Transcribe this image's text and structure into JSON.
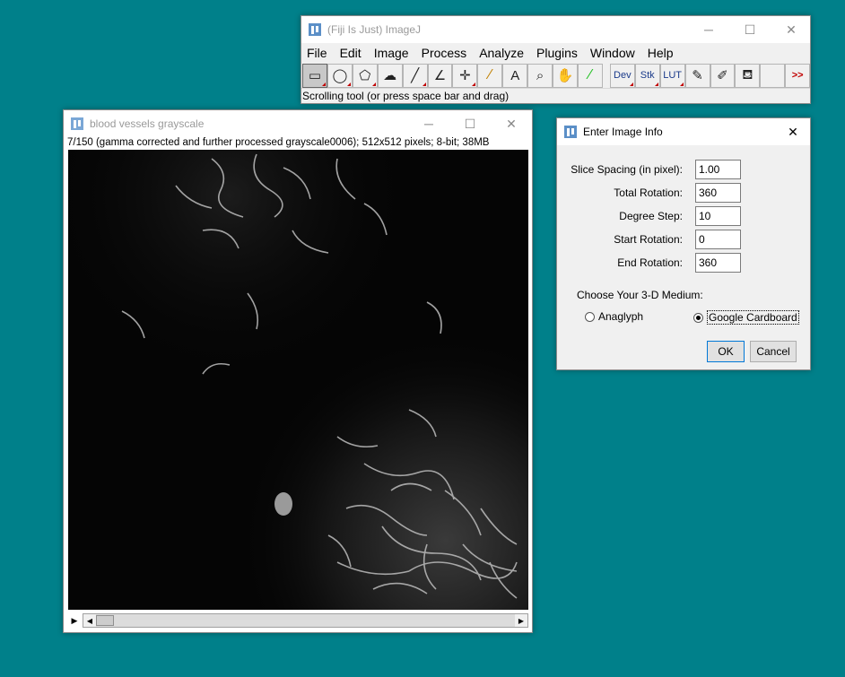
{
  "imagej": {
    "title": "(Fiji Is Just) ImageJ",
    "menus": [
      "File",
      "Edit",
      "Image",
      "Process",
      "Analyze",
      "Plugins",
      "Window",
      "Help"
    ],
    "tools": [
      {
        "icon": "rectangle-select-icon",
        "glyph": "▭",
        "selected": true,
        "menu": true
      },
      {
        "icon": "oval-select-icon",
        "glyph": "◯",
        "menu": true
      },
      {
        "icon": "polygon-select-icon",
        "glyph": "⬠",
        "menu": true
      },
      {
        "icon": "freehand-select-icon",
        "glyph": "☁",
        "menu": false
      },
      {
        "icon": "line-tool-icon",
        "glyph": "╱",
        "menu": true
      },
      {
        "icon": "angle-tool-icon",
        "glyph": "∠",
        "menu": false
      },
      {
        "icon": "point-tool-icon",
        "glyph": "✛",
        "menu": true
      },
      {
        "icon": "wand-tool-icon",
        "glyph": "⁄",
        "menu": false
      },
      {
        "icon": "text-tool-icon",
        "glyph": "A",
        "menu": false
      },
      {
        "icon": "magnifier-icon",
        "glyph": "⌕",
        "menu": false
      },
      {
        "icon": "hand-scroll-icon",
        "glyph": "✋",
        "menu": false
      },
      {
        "icon": "color-picker-icon",
        "glyph": "⁄",
        "menu": false
      },
      {
        "icon": "dev-menu-icon",
        "glyph": "Dev",
        "menu": true,
        "gap": true
      },
      {
        "icon": "stack-menu-icon",
        "glyph": "Stk",
        "menu": true
      },
      {
        "icon": "lut-menu-icon",
        "glyph": "LUT",
        "menu": true
      },
      {
        "icon": "pencil-tool-icon",
        "glyph": "✎",
        "menu": false
      },
      {
        "icon": "brush-tool-icon",
        "glyph": "✐",
        "menu": false
      },
      {
        "icon": "flood-fill-icon",
        "glyph": "⛾",
        "menu": false
      },
      {
        "icon": "blank-tool-icon",
        "glyph": "",
        "menu": false
      },
      {
        "icon": "more-tools-icon",
        "glyph": ">>",
        "menu": false
      }
    ],
    "status": "Scrolling tool (or press space bar and drag)"
  },
  "image_window": {
    "title": "blood vessels grayscale",
    "info": "7/150 (gamma corrected and further processed grayscale0006); 512x512 pixels; 8-bit; 38MB"
  },
  "dialog": {
    "title": "Enter Image Info",
    "fields": [
      {
        "label": "Slice Spacing (in pixel):",
        "value": "1.00"
      },
      {
        "label": "Total Rotation:",
        "value": "360"
      },
      {
        "label": "Degree Step:",
        "value": "10"
      },
      {
        "label": "Start Rotation:",
        "value": "0"
      },
      {
        "label": "End Rotation:",
        "value": "360"
      }
    ],
    "medium_label": "Choose Your 3-D Medium:",
    "options": [
      {
        "label": "Anaglyph",
        "selected": false
      },
      {
        "label": "Google Cardboard",
        "selected": true
      }
    ],
    "ok_label": "OK",
    "cancel_label": "Cancel"
  },
  "colors": {
    "desktop": "#00808a",
    "accent": "#0078d7"
  }
}
